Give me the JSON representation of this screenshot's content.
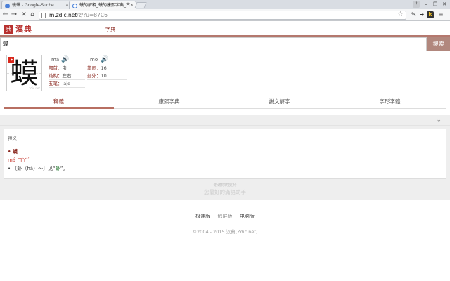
{
  "browser": {
    "tabs": [
      {
        "title": "蟆蟆 - Google-Suche",
        "active": false
      },
      {
        "title": "蟆的解释_蟆的康熙字典_古",
        "active": true
      }
    ],
    "url_host": "m.zdic.net",
    "url_path": "/z/?u=87C6",
    "profile_label": "?"
  },
  "site": {
    "logo_seal": "典",
    "logo_text": "漢典",
    "nav_label": "字典"
  },
  "search": {
    "value": "蟆",
    "button_label": "搜索"
  },
  "character": {
    "glyph": "蟆",
    "watermark": "zdic.net",
    "pinyin": [
      "má",
      "mò"
    ],
    "info": [
      {
        "label": "部首：",
        "value": "虫"
      },
      {
        "label": "笔画：",
        "value": "16"
      },
      {
        "label": "结构：",
        "value": "左右"
      },
      {
        "label": "部外：",
        "value": "10"
      },
      {
        "label": "五笔：",
        "value": "jajd"
      }
    ]
  },
  "tabs": [
    "釋義",
    "康熙字典",
    "說文解字",
    "字形字體"
  ],
  "panel": {
    "title": "釋义",
    "entry_head": "• 蟆",
    "entry_pinyin": "má ㄇㄚˊ",
    "entry_def_prefix": "• 〔虾（há）～〕见“",
    "entry_def_link": "虾",
    "entry_def_suffix": "”。"
  },
  "support": {
    "line1": "谢谢你的支持",
    "line2": "您最好的滿語助手"
  },
  "footer": {
    "links": [
      "极速版",
      "触屏版",
      "电脑版"
    ],
    "copyright": "©2004 - 2015 汉典(Zdic.net)"
  },
  "colors": {
    "accent": "#b8312f",
    "search_button": "#b1877d",
    "link_green": "#2a7a34"
  }
}
